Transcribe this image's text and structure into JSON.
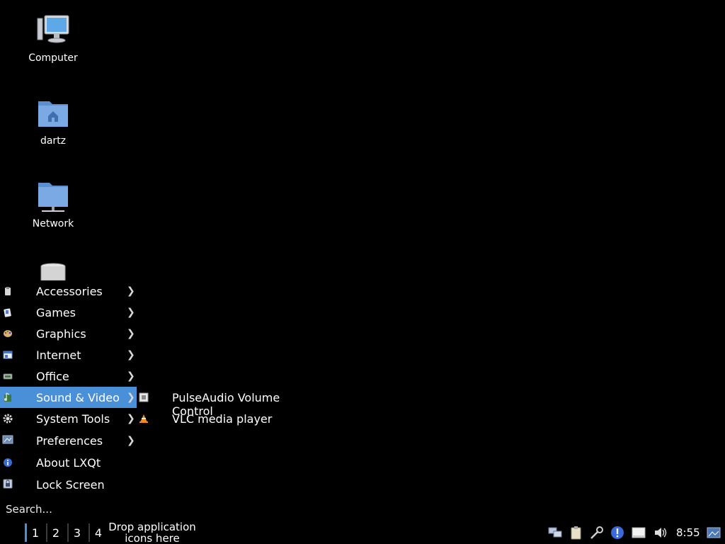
{
  "desktop": {
    "icons": [
      {
        "label": "Computer",
        "icon": "computer-icon"
      },
      {
        "label": "dartz",
        "icon": "home-folder-icon"
      },
      {
        "label": "Network",
        "icon": "network-folder-icon"
      },
      {
        "label": "",
        "icon": "trash-icon"
      }
    ]
  },
  "menu": {
    "items": [
      {
        "label": "Accessories",
        "icon": "accessories-icon",
        "arrow": "❯"
      },
      {
        "label": "Games",
        "icon": "games-icon",
        "arrow": "❯"
      },
      {
        "label": "Graphics",
        "icon": "graphics-icon",
        "arrow": "❯"
      },
      {
        "label": "Internet",
        "icon": "internet-icon",
        "arrow": "❯"
      },
      {
        "label": "Office",
        "icon": "office-icon",
        "arrow": "❯"
      },
      {
        "label": "Sound & Video",
        "icon": "sound-video-icon",
        "arrow": "❯",
        "active": true
      },
      {
        "label": "System Tools",
        "icon": "system-tools-icon",
        "arrow": "❯"
      },
      {
        "label": "Preferences",
        "icon": "preferences-icon",
        "arrow": "❯"
      },
      {
        "label": "About LXQt",
        "icon": "info-icon"
      },
      {
        "label": "Lock Screen",
        "icon": "lock-icon"
      }
    ],
    "search_placeholder": "Search..."
  },
  "submenu": {
    "items": [
      {
        "label": "PulseAudio Volume Control",
        "icon": "pulseaudio-icon"
      },
      {
        "label": "VLC media player",
        "icon": "vlc-icon"
      }
    ]
  },
  "taskbar": {
    "workspaces": [
      "1",
      "2",
      "3",
      "4"
    ],
    "active_workspace": "1",
    "quicklaunch_line1": "Drop application",
    "quicklaunch_line2": "icons here",
    "clock": "8:55",
    "tray_icons": [
      "network-icon",
      "clipboard-icon",
      "screenshot-icon",
      "update-alert-icon",
      "removable-drive-icon",
      "volume-icon",
      "show-desktop-icon"
    ]
  },
  "colors": {
    "background": "#000000",
    "accent": "#4a90d9",
    "text": "#ffffff"
  }
}
